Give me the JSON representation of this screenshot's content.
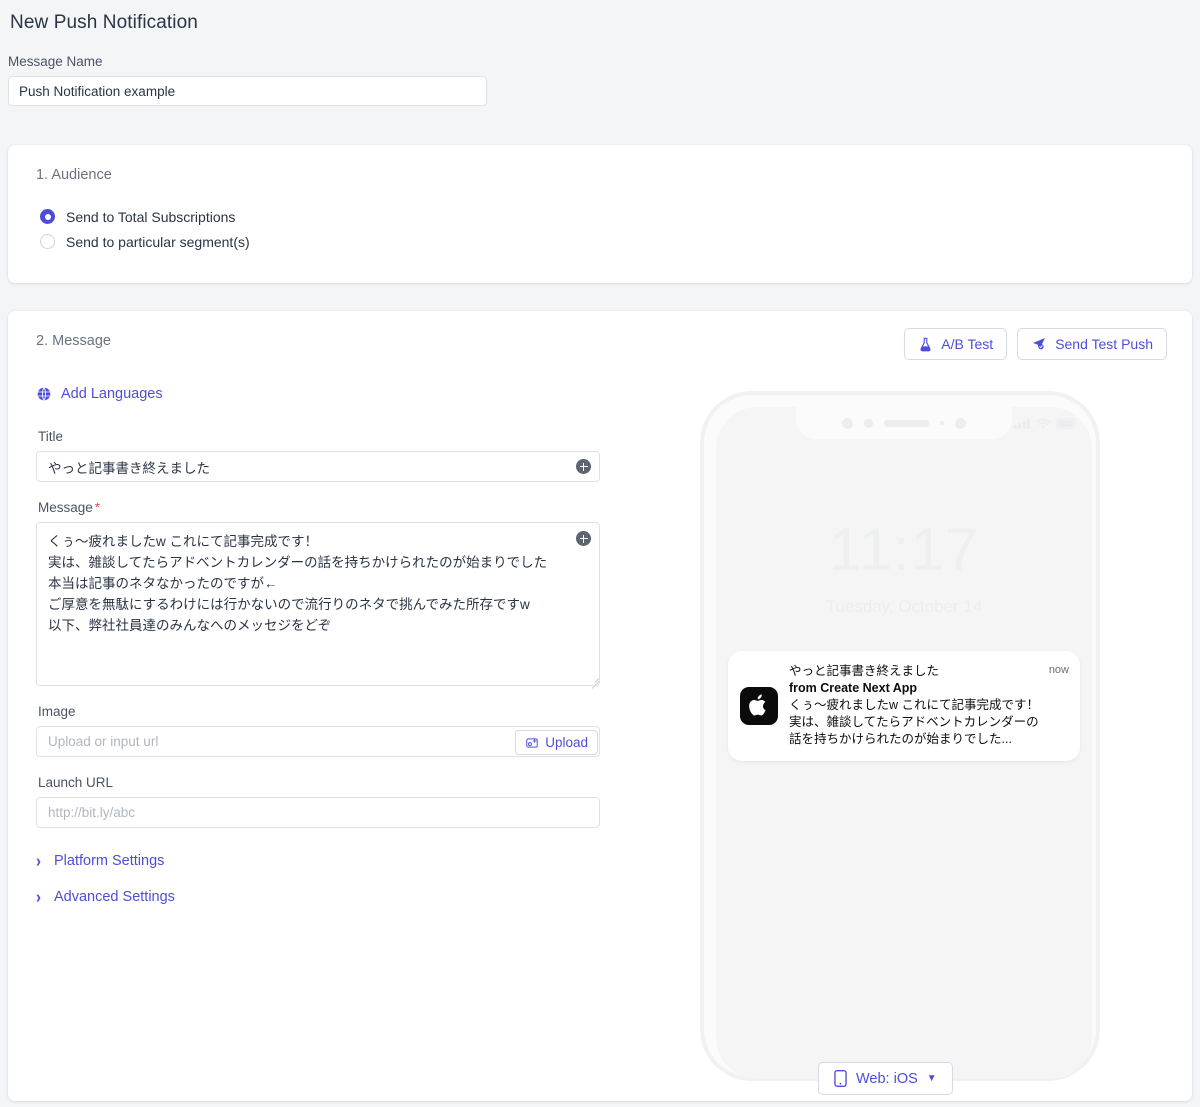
{
  "page": {
    "title": "New Push Notification"
  },
  "message_name": {
    "label": "Message Name",
    "value": "Push Notification example"
  },
  "audience": {
    "section_title": "1. Audience",
    "options": [
      {
        "label": "Send to Total Subscriptions",
        "selected": true
      },
      {
        "label": "Send to particular segment(s)",
        "selected": false
      }
    ]
  },
  "message": {
    "section_title": "2. Message",
    "ab_test_label": "A/B Test",
    "send_test_push_label": "Send Test Push",
    "add_languages_label": "Add Languages",
    "title_label": "Title",
    "title_value": "やっと記事書き終えました",
    "body_label": "Message",
    "body_required_mark": "*",
    "body_value": "くぅ〜疲れましたw これにて記事完成です！\n実は、雑談してたらアドベントカレンダーの話を持ちかけられたのが始まりでした\n本当は記事のネタなかったのですが←\nご厚意を無駄にするわけには行かないので流行りのネタで挑んでみた所存ですw\n以下、弊社社員達のみんなへのメッセジをどぞ",
    "image_label": "Image",
    "image_placeholder": "Upload or input url",
    "image_value": "",
    "upload_label": "Upload",
    "launch_url_label": "Launch URL",
    "launch_url_placeholder": "http://bit.ly/abc",
    "launch_url_value": "",
    "platform_settings_label": "Platform Settings",
    "advanced_settings_label": "Advanced Settings"
  },
  "preview": {
    "clock": "11:17",
    "date": "Tuesday, October 14",
    "notification": {
      "title": "やっと記事書き終えました",
      "app_name": "from Create Next App",
      "text": "くぅ〜疲れましたw これにて記事完成です！\n実は、雑談してたらアドベントカレンダーの話を持ちかけられたのが始まりでした...",
      "time": "now"
    },
    "platform_label": "Web: iOS"
  },
  "colors": {
    "accent": "#4e4ddb",
    "page_bg": "#f4f5f7",
    "card_bg": "#ffffff",
    "text": "#2b3445",
    "muted": "#6b7280",
    "required": "#e5484d"
  }
}
